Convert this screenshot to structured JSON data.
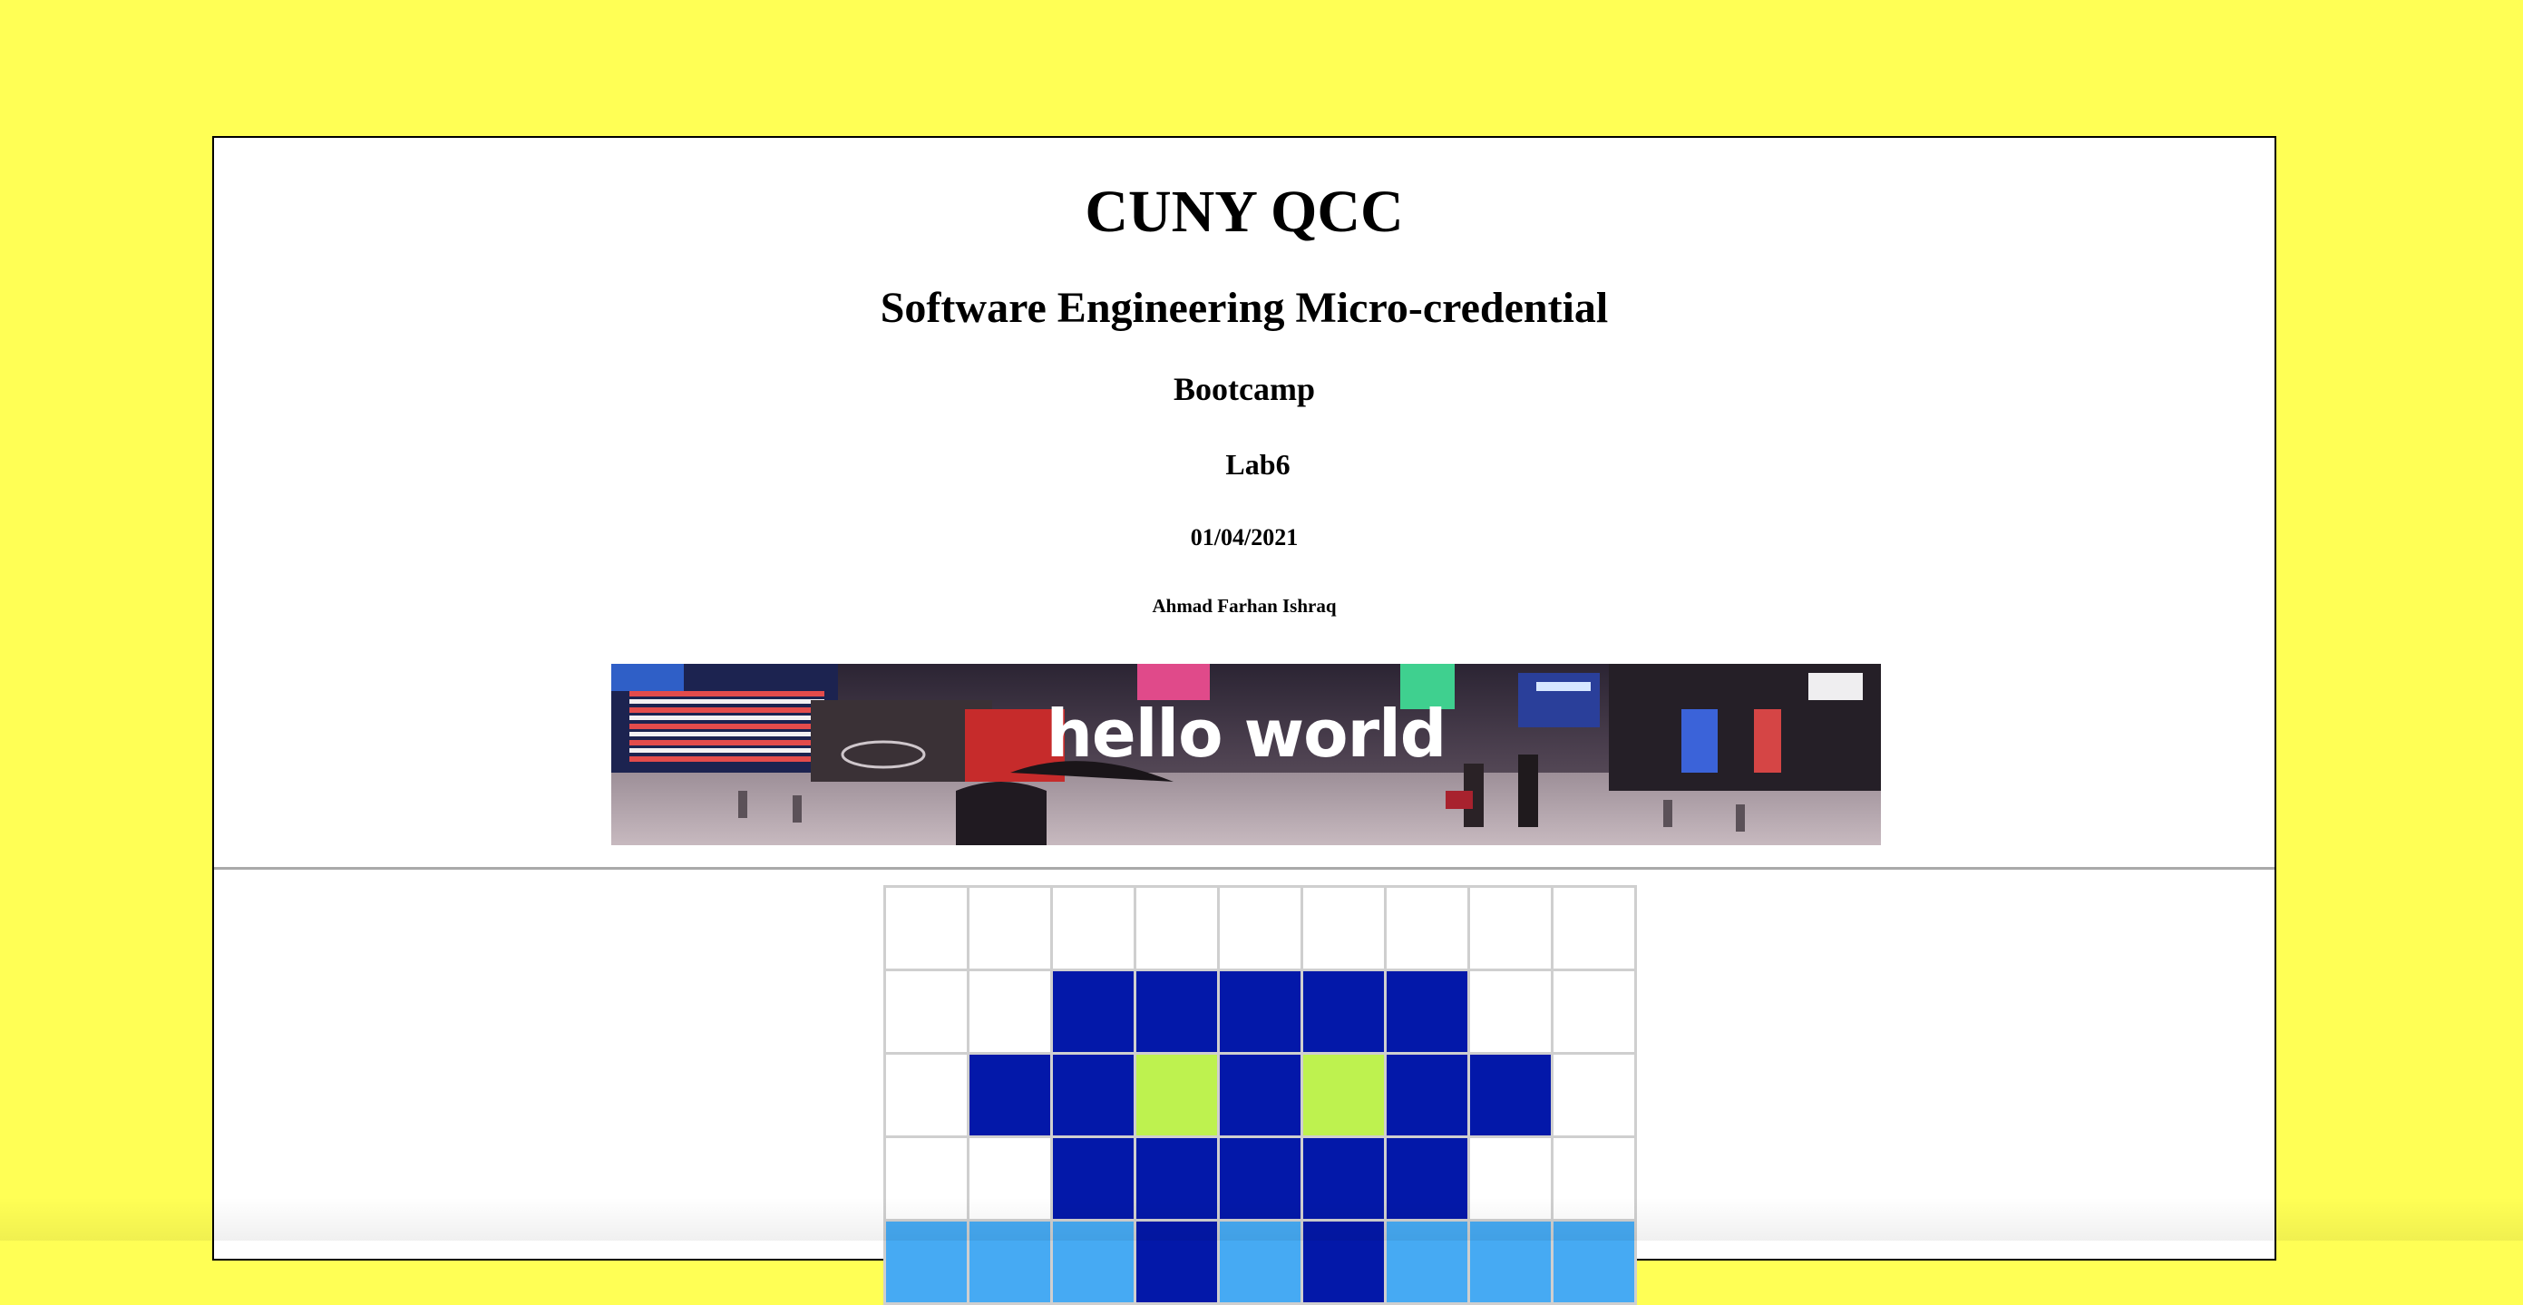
{
  "header": {
    "title": "CUNY QCC",
    "subtitle": "Software Engineering Micro-credential",
    "program": "Bootcamp",
    "lab": "Lab6",
    "date": "01/04/2021",
    "author": "Ahmad Farhan Ishraq"
  },
  "banner": {
    "text": "hello world",
    "icon": "city-street-photo"
  },
  "colors": {
    "page_background": "#ffff55",
    "content_background": "#ffffff",
    "pixel_white": "#ffffff",
    "pixel_navy": "#0318a9",
    "pixel_lime": "#bef24f",
    "pixel_sky": "#46aaf3"
  },
  "pixel_grid": {
    "columns": 9,
    "rows": [
      [
        "white",
        "white",
        "white",
        "white",
        "white",
        "white",
        "white",
        "white",
        "white"
      ],
      [
        "white",
        "white",
        "navy",
        "navy",
        "navy",
        "navy",
        "navy",
        "white",
        "white"
      ],
      [
        "white",
        "navy",
        "navy",
        "lime",
        "navy",
        "lime",
        "navy",
        "navy",
        "white"
      ],
      [
        "white",
        "white",
        "navy",
        "navy",
        "navy",
        "navy",
        "navy",
        "white",
        "white"
      ],
      [
        "sky",
        "sky",
        "sky",
        "navy",
        "sky",
        "navy",
        "sky",
        "sky",
        "sky"
      ]
    ]
  }
}
